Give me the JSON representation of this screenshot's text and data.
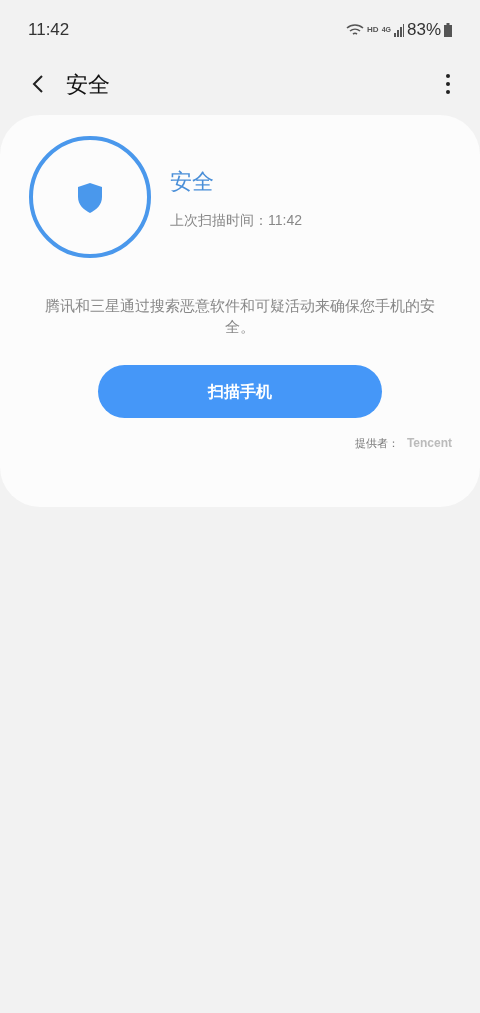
{
  "status_bar": {
    "time": "11:42",
    "network": "HD",
    "network_type": "4G",
    "battery": "83%"
  },
  "header": {
    "title": "安全"
  },
  "card": {
    "status": "安全",
    "last_scan": "上次扫描时间：11:42",
    "description": "腾讯和三星通过搜索恶意软件和可疑活动来确保您手机的安全。",
    "button": "扫描手机",
    "provider_label": "提供者：",
    "provider": "Tencent"
  }
}
